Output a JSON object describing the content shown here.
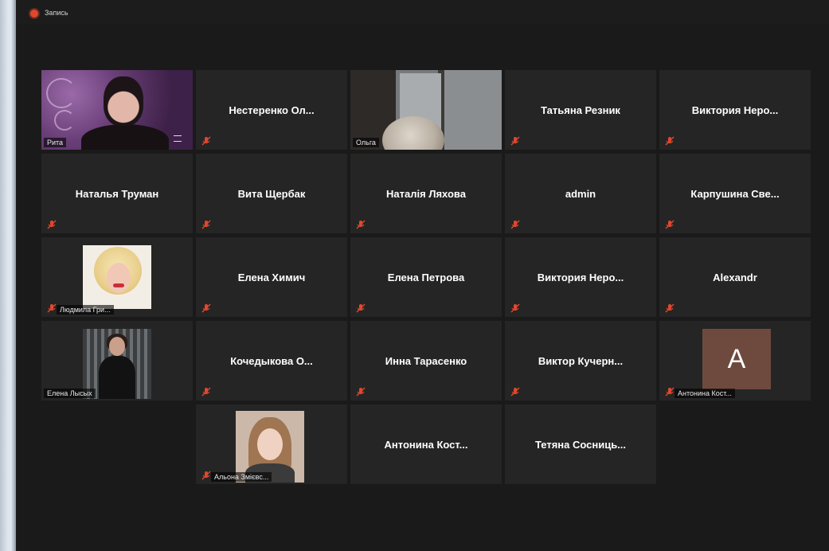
{
  "window": {
    "recording_label": "Запись"
  },
  "participants": [
    {
      "name": "Рита",
      "type": "video",
      "active": true
    },
    {
      "name": "Нестеренко  Ол...",
      "type": "name"
    },
    {
      "name": "Ольга",
      "type": "video"
    },
    {
      "name": "Татьяна Резник",
      "type": "name"
    },
    {
      "name": "Виктория  Неро...",
      "type": "name"
    },
    {
      "name": "Наталья Труман",
      "type": "name"
    },
    {
      "name": "Вита Щербак",
      "type": "name"
    },
    {
      "name": "Наталія Ляхова",
      "type": "name"
    },
    {
      "name": "admin",
      "type": "name"
    },
    {
      "name": "Карпушина  Све...",
      "type": "name"
    },
    {
      "name": "Людмила Гри...",
      "type": "photo"
    },
    {
      "name": "Елена Химич",
      "type": "name"
    },
    {
      "name": "Елена Петрова",
      "type": "name"
    },
    {
      "name": "Виктория  Неро...",
      "type": "name"
    },
    {
      "name": "Alexandr",
      "type": "name"
    },
    {
      "name": "Елена Лысых",
      "type": "photo"
    },
    {
      "name": "Кочедыкова  О...",
      "type": "name"
    },
    {
      "name": "Инна Тарасенко",
      "type": "name"
    },
    {
      "name": "Виктор  Кучерн...",
      "type": "name"
    },
    {
      "name": "Антонина Кост...",
      "type": "avatar",
      "initial": "A"
    },
    {
      "name": "Альона Змієвс...",
      "type": "photo"
    },
    {
      "name": "Антонина  Кост...",
      "type": "name"
    },
    {
      "name": "Тетяна  Сосниць...",
      "type": "name"
    }
  ],
  "colors": {
    "tile_bg": "#252525",
    "active_speaker_border": "#d5d999",
    "muted_icon": "#e0482e",
    "avatar_bg": "#6e4a3e"
  },
  "icons": {
    "muted": "muted-mic-icon",
    "recording": "recording-icon"
  }
}
